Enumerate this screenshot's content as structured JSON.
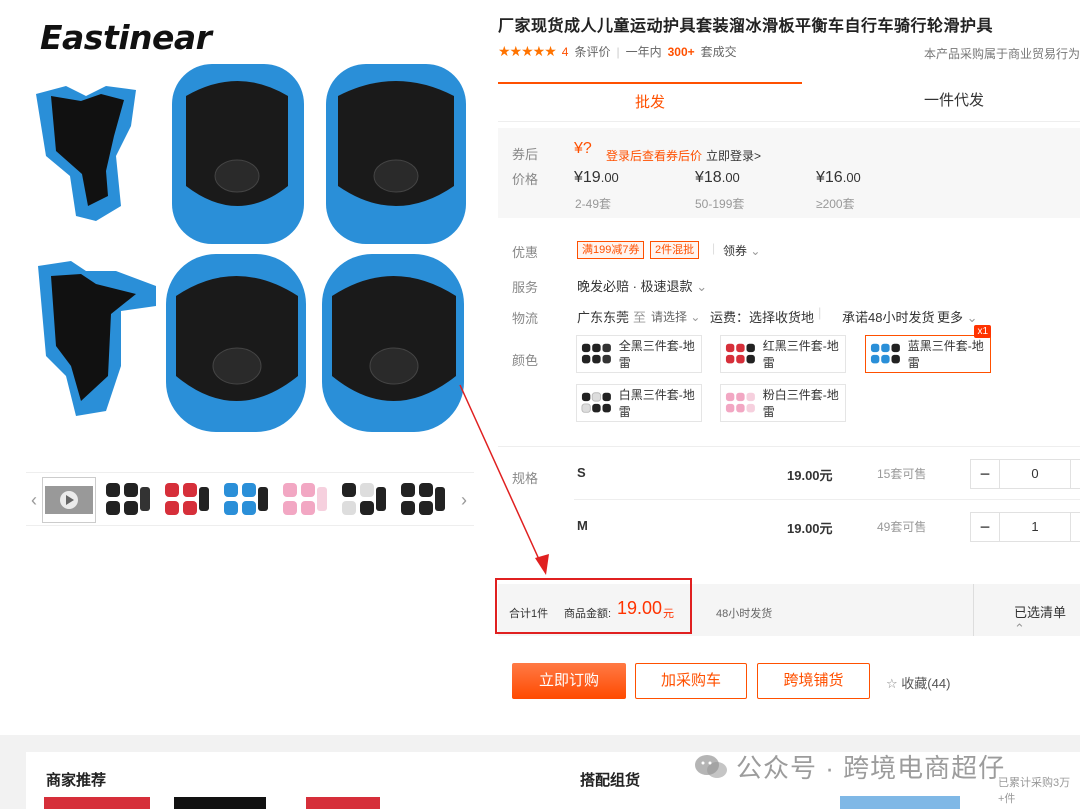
{
  "brand": {
    "logo_text": "Eastinear"
  },
  "product": {
    "title": "厂家现货成人儿童运动护具套装溜冰滑板平衡车自行车骑行轮滑护具",
    "stars": "★★★★★",
    "review_count": "4",
    "review_suffix": "条评价",
    "year_label": "一年内",
    "year_sold": "300+",
    "sold_suffix": "套成交",
    "biz_note": "本产品采购属于商业贸易行为"
  },
  "tabs": [
    {
      "label": "批发",
      "active": true
    },
    {
      "label": "一件代发",
      "active": false
    }
  ],
  "price": {
    "coupon_label": "券后",
    "coupon_value": "¥?",
    "coupon_hint": "登录后查看券后价",
    "login_link": "立即登录>",
    "price_label": "价格",
    "tiers": [
      {
        "price": "19",
        "decimal": ".00",
        "range": "2-49套"
      },
      {
        "price": "18",
        "decimal": ".00",
        "range": "50-199套"
      },
      {
        "price": "16",
        "decimal": ".00",
        "range": "≥200套"
      }
    ],
    "currency": "¥"
  },
  "discount": {
    "label": "优惠",
    "coupons": [
      "满199减7券",
      "2件混批"
    ],
    "claim": "领券"
  },
  "service": {
    "label": "服务",
    "value": "晚发必赔 · 极速退款"
  },
  "logistics": {
    "label": "物流",
    "origin": "广东东莞",
    "to": "至",
    "select": "请选择",
    "fee": "运费：选择收货地",
    "promise": "承诺48小时发货",
    "more": "更多"
  },
  "colors": {
    "label": "颜色",
    "options": [
      {
        "name": "全黑三件套-地雷",
        "selected": false,
        "c1": "#222",
        "c2": "#333"
      },
      {
        "name": "红黑三件套-地雷",
        "selected": false,
        "c1": "#222",
        "c2": "#d62f3a"
      },
      {
        "name": "蓝黑三件套-地雷",
        "selected": true,
        "c1": "#222",
        "c2": "#2a8fd8",
        "badge": "x1"
      },
      {
        "name": "白黑三件套-地雷",
        "selected": false,
        "c1": "#222",
        "c2": "#ddd"
      },
      {
        "name": "粉白三件套-地雷",
        "selected": false,
        "c1": "#f2a7c3",
        "c2": "#f6d0de"
      }
    ]
  },
  "spec": {
    "label": "规格",
    "rows": [
      {
        "name": "S",
        "price": "19.00元",
        "stock": "15套可售",
        "qty": "0"
      },
      {
        "name": "M",
        "price": "19.00元",
        "stock": "49套可售",
        "qty": "1"
      }
    ],
    "minus": "−",
    "plus": "+"
  },
  "total": {
    "count": "合计1件",
    "amount_label": "商品金额:",
    "amount": "19.00",
    "unit": "元",
    "ship": "48小时发货",
    "selected": "已选清单",
    "selected_icon": "chevron-up-icon"
  },
  "actions": {
    "buy": "立即订购",
    "cart": "加采购车",
    "cross": "跨境铺货",
    "fav": "收藏(44)"
  },
  "bottom": {
    "merchant": "商家推荐",
    "combo": "搭配组货",
    "sold_note": "已累计采购3万+件"
  },
  "watermark": {
    "text": "公众号 · 跨境电商超仔"
  },
  "colors_theme": {
    "accent": "#ff5000",
    "highlight": "#e02020",
    "pad_blue": "#2a8fd8"
  }
}
